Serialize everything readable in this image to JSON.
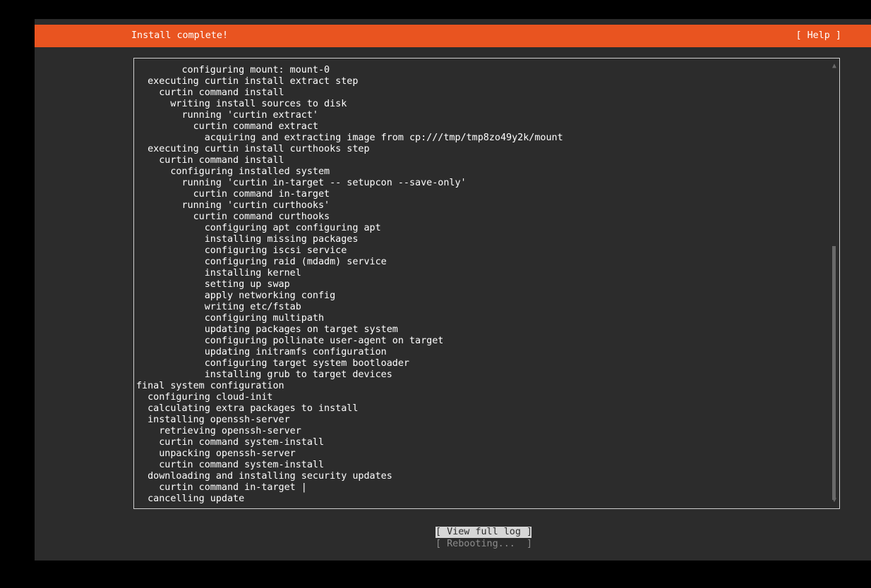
{
  "header": {
    "title": "Install complete!",
    "help_label": "[ Help ]"
  },
  "log": {
    "lines": [
      "        configuring mount: mount-0",
      "  executing curtin install extract step",
      "    curtin command install",
      "      writing install sources to disk",
      "        running 'curtin extract'",
      "          curtin command extract",
      "            acquiring and extracting image from cp:///tmp/tmp8zo49y2k/mount",
      "  executing curtin install curthooks step",
      "    curtin command install",
      "      configuring installed system",
      "        running 'curtin in-target -- setupcon --save-only'",
      "          curtin command in-target",
      "        running 'curtin curthooks'",
      "          curtin command curthooks",
      "            configuring apt configuring apt",
      "            installing missing packages",
      "            configuring iscsi service",
      "            configuring raid (mdadm) service",
      "            installing kernel",
      "            setting up swap",
      "            apply networking config",
      "            writing etc/fstab",
      "            configuring multipath",
      "            updating packages on target system",
      "            configuring pollinate user-agent on target",
      "            updating initramfs configuration",
      "            configuring target system bootloader",
      "            installing grub to target devices",
      "final system configuration",
      "  configuring cloud-init",
      "  calculating extra packages to install",
      "  installing openssh-server",
      "    retrieving openssh-server",
      "    curtin command system-install",
      "    unpacking openssh-server",
      "    curtin command system-install",
      "  downloading and installing security updates",
      "    curtin command in-target |",
      "  cancelling update"
    ],
    "scroll_up_icon": "▲",
    "scroll_down_icon": "▼",
    "scroll_position_fraction": 0.41,
    "scroll_visible_fraction": 0.6
  },
  "actions": {
    "view_log_label": "[ View full log ]",
    "rebooting_label": "[ Rebooting...  ]"
  },
  "colors": {
    "accent": "#e95420",
    "background": "#2c2c2c",
    "text": "#ffffff",
    "scrollbar": "#6a6a6a",
    "selected_button_bg": "#d6d6d6",
    "disabled_text": "#8c8c8c"
  }
}
